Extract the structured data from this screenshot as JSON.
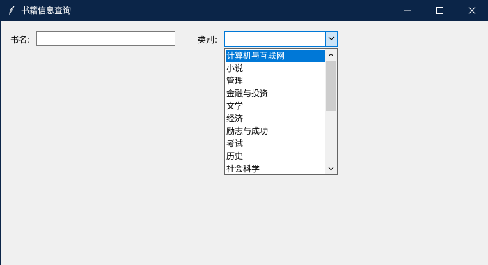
{
  "window": {
    "title": "书籍信息查询",
    "icons": {
      "app": "feather-icon",
      "minimize": "minimize-icon",
      "maximize": "maximize-icon",
      "close": "close-icon"
    }
  },
  "form": {
    "name_label": "书名:",
    "name_value": "",
    "category_label": "类别:",
    "category_value": ""
  },
  "dropdown": {
    "selected_index": 0,
    "options": [
      "计算机与互联网",
      "小说",
      "管理",
      "金融与投资",
      "文学",
      "经济",
      "励志与成功",
      "考试",
      "历史",
      "社会科学"
    ]
  },
  "colors": {
    "titlebar": "#0b2548",
    "accent": "#0078d7",
    "background": "#f0f0f0"
  }
}
